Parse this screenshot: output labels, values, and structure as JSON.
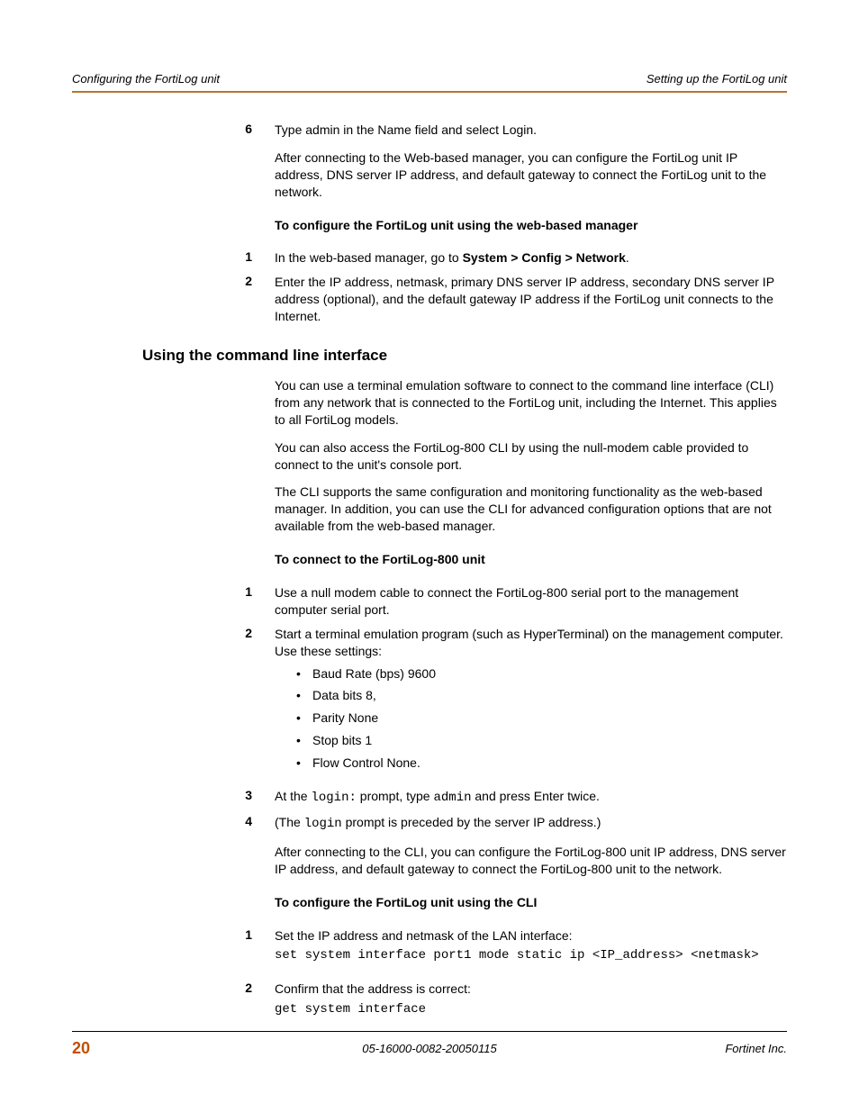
{
  "header": {
    "left": "Configuring the FortiLog unit",
    "right": "Setting up the FortiLog unit"
  },
  "step6": {
    "num": "6",
    "text_a": "Type admin in the Name field and select Login.",
    "text_b": "After connecting to the Web-based manager, you can configure the FortiLog unit IP address, DNS server IP address, and default gateway to connect the FortiLog unit to the network."
  },
  "sub1": {
    "title": "To configure the FortiLog unit using the web-based manager",
    "s1_num": "1",
    "s1_a": "In the web-based manager, go to ",
    "s1_b": "System > Config > Network",
    "s1_c": ".",
    "s2_num": "2",
    "s2": "Enter the IP address, netmask, primary DNS server IP address, secondary DNS server IP address (optional), and the default gateway IP address if the FortiLog unit connects to the Internet."
  },
  "section2": {
    "title": "Using the command line interface",
    "p1": "You can use a terminal emulation software to connect to the command line interface (CLI) from any network that is connected to the FortiLog unit, including the Internet. This applies to all FortiLog models.",
    "p2": "You can also access the FortiLog-800 CLI by using the null-modem cable provided to connect to the unit's console port.",
    "p3": "The CLI supports the same configuration and monitoring functionality as the web-based manager. In addition, you can use the CLI for advanced configuration options that are not available from the web-based manager."
  },
  "sub2": {
    "title": "To connect to the FortiLog-800 unit",
    "s1_num": "1",
    "s1": "Use a null modem cable to connect the FortiLog-800 serial port to the management computer serial port.",
    "s2_num": "2",
    "s2": "Start a terminal emulation program (such as HyperTerminal) on the management computer. Use these settings:",
    "b1": "Baud Rate (bps) 9600",
    "b2": "Data bits 8,",
    "b3": "Parity None",
    "b4": "Stop bits 1",
    "b5": "Flow Control None.",
    "s3_num": "3",
    "s3_a": "At the ",
    "s3_b": "login:",
    "s3_c": " prompt, type ",
    "s3_d": "admin",
    "s3_e": " and press Enter twice.",
    "s4_num": "4",
    "s4_a": "(The ",
    "s4_b": "login",
    "s4_c": " prompt is preceded by the server IP address.)",
    "s4_p": "After connecting to the CLI, you can configure the FortiLog-800 unit IP address, DNS server IP address, and default gateway to connect the FortiLog-800 unit to the network."
  },
  "sub3": {
    "title": "To configure the FortiLog unit using the CLI",
    "s1_num": "1",
    "s1": "Set the IP address and netmask of the LAN interface:",
    "s1_code": "set system interface port1 mode static ip <IP_address> <netmask>",
    "s2_num": "2",
    "s2": "Confirm that the address is correct:",
    "s2_code": "get system interface"
  },
  "footer": {
    "page": "20",
    "center": "05-16000-0082-20050115",
    "right": "Fortinet Inc."
  }
}
